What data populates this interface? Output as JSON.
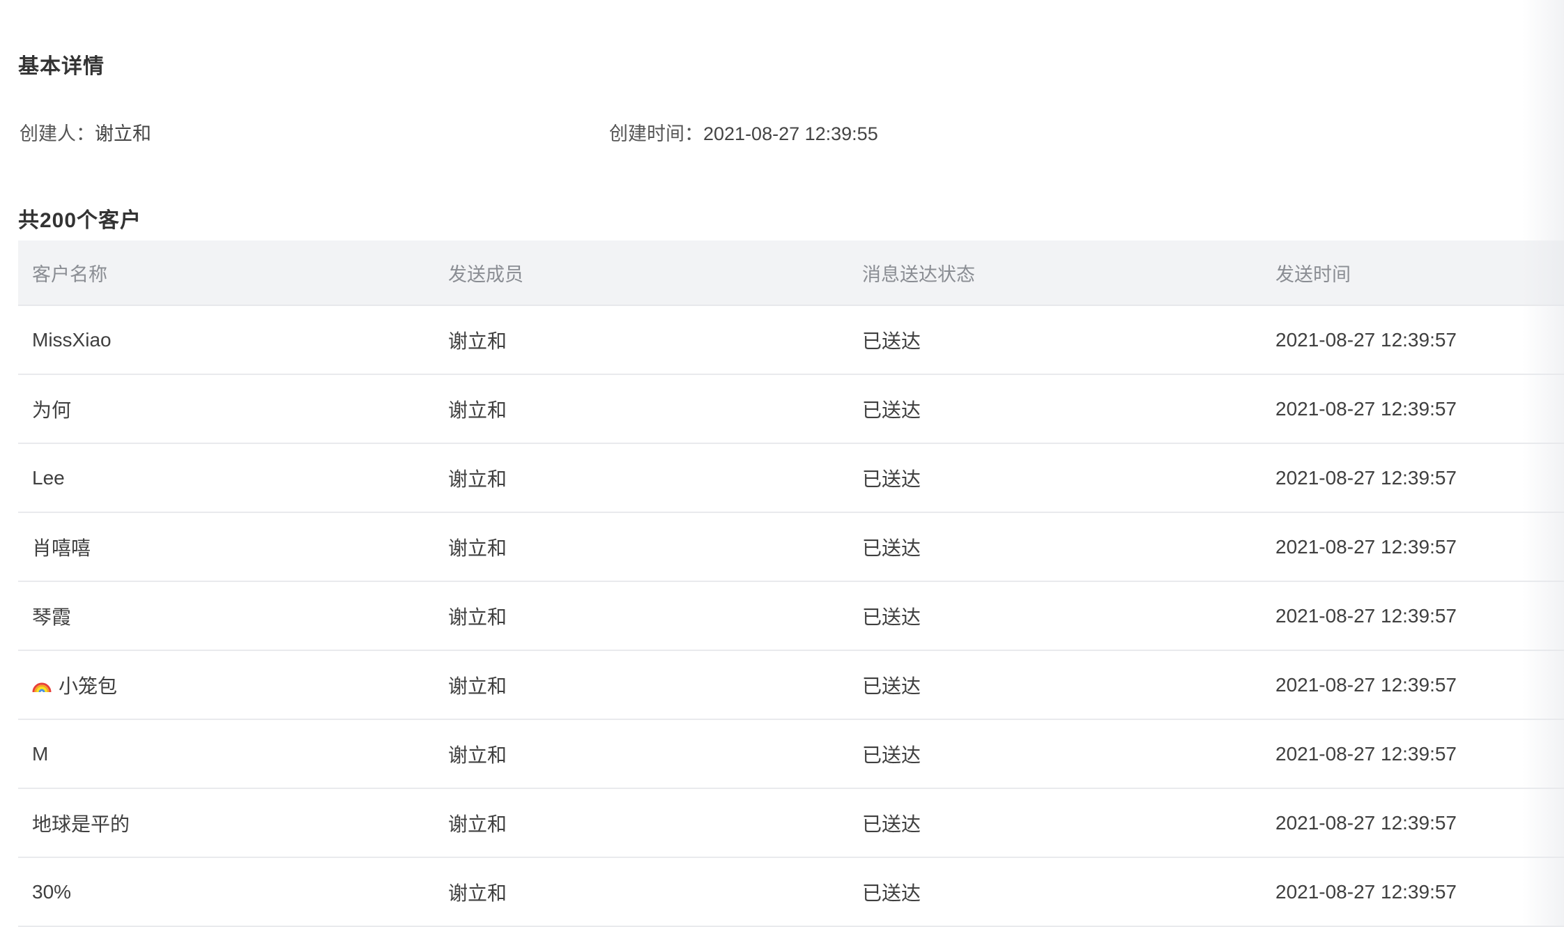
{
  "basic": {
    "title": "基本详情",
    "creator_label": "创建人：",
    "creator_value": "谢立和",
    "created_time_label": "创建时间：",
    "created_time_value": "2021-08-27 12:39:55"
  },
  "customers": {
    "title": "共200个客户",
    "columns": [
      "客户名称",
      "发送成员",
      "消息送达状态",
      "发送时间"
    ],
    "rows": [
      {
        "name": "MissXiao",
        "member": "谢立和",
        "status": "已送达",
        "time": "2021-08-27 12:39:57"
      },
      {
        "name": "为何",
        "member": "谢立和",
        "status": "已送达",
        "time": "2021-08-27 12:39:57"
      },
      {
        "name": "Lee",
        "member": "谢立和",
        "status": "已送达",
        "time": "2021-08-27 12:39:57"
      },
      {
        "name": "肖嘻嘻",
        "member": "谢立和",
        "status": "已送达",
        "time": "2021-08-27 12:39:57"
      },
      {
        "name": "琴霞",
        "member": "谢立和",
        "status": "已送达",
        "time": "2021-08-27 12:39:57"
      },
      {
        "name": "小笼包",
        "name_icon": "rainbow-icon",
        "member": "谢立和",
        "status": "已送达",
        "time": "2021-08-27 12:39:57"
      },
      {
        "name": "M",
        "member": "谢立和",
        "status": "已送达",
        "time": "2021-08-27 12:39:57"
      },
      {
        "name": "地球是平的",
        "member": "谢立和",
        "status": "已送达",
        "time": "2021-08-27 12:39:57"
      },
      {
        "name": "30%",
        "member": "谢立和",
        "status": "已送达",
        "time": "2021-08-27 12:39:57"
      }
    ]
  },
  "colors": {
    "text_primary": "#333333",
    "header_bg": "#f2f3f5",
    "header_text": "#8a8d93",
    "divider": "#e9eaed"
  }
}
